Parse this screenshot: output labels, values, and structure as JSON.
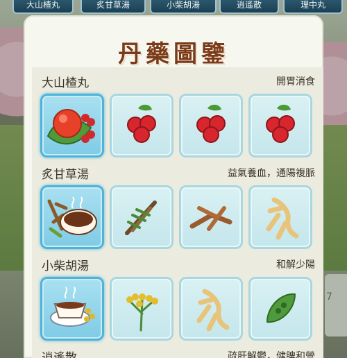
{
  "tabs": [
    "大山楂丸",
    "炙甘草湯",
    "小柴胡湯",
    "逍遙散",
    "理中丸"
  ],
  "title": "丹藥圖鑒",
  "background": {
    "partial_number": "7"
  },
  "recipes": [
    {
      "name": "大山楂丸",
      "effect": "開胃消食",
      "main_icon": "hawthorn-pill-icon",
      "ingredients": [
        "hawthorn-berry-icon",
        "hawthorn-berry-icon",
        "hawthorn-berry-icon"
      ]
    },
    {
      "name": "炙甘草湯",
      "effect": "益氣養血，通陽複脈",
      "main_icon": "licorice-decoction-icon",
      "ingredients": [
        "herb-bundle-icon",
        "licorice-root-icon",
        "ginseng-root-icon"
      ]
    },
    {
      "name": "小柴胡湯",
      "effect": "和解少陽",
      "main_icon": "bupleurum-decoction-icon",
      "ingredients": [
        "bupleurum-flower-icon",
        "ginseng-root-icon",
        "seed-pod-icon"
      ]
    },
    {
      "name": "逍遙散",
      "effect": "疏肝解鬱，健脾和營",
      "main_icon": "",
      "ingredients": []
    }
  ],
  "colors": {
    "title": "#7b3b17",
    "tile_main": "#7fcbe6",
    "tile": "#c4e6ec",
    "tab": "#1c3f52"
  }
}
